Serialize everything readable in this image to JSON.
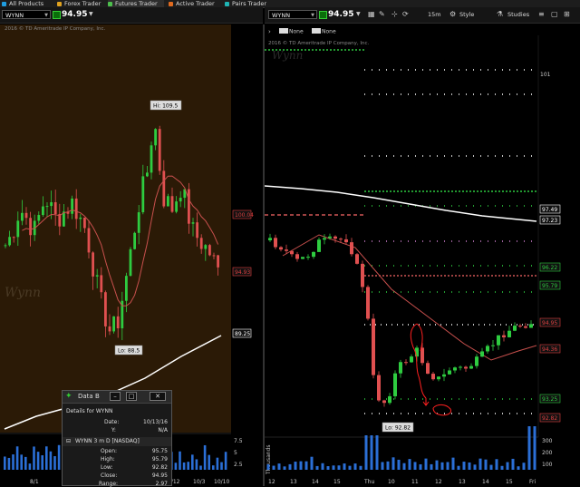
{
  "topbar": {
    "items": [
      {
        "label": "All Products",
        "color": "#1f9de0"
      },
      {
        "label": "Forex Trader",
        "color": "#e0a21f"
      },
      {
        "label": "Futures Trader",
        "color": "#4cbf4c"
      },
      {
        "label": "Active Trader",
        "color": "#e06a1f"
      },
      {
        "label": "Pairs Trader",
        "color": "#1fb5b5"
      }
    ]
  },
  "left_chart": {
    "symbol": "WYNN",
    "price": "94.95",
    "watermark": "2016 © TD Ameritrade IP Company, Inc.",
    "signature": "Wynn",
    "hi_label": "Hi: 109.5",
    "lo_label": "Lo: 88.5",
    "price_badges": [
      {
        "text": "100.04",
        "color": "#e04040",
        "y": 100.04
      },
      {
        "text": "94.93",
        "color": "#e04040",
        "y": 94.93
      },
      {
        "text": "89.25",
        "color": "#ffffff",
        "y": 89.25
      }
    ],
    "x_ticks": [
      "8/1",
      "9/12",
      "10/3",
      "10/10"
    ],
    "volume_ticks": [
      "7.5",
      "5",
      "2.5"
    ]
  },
  "right_chart": {
    "symbol": "WYNN",
    "price": "94.95",
    "interval": "15m",
    "style_label": "Style",
    "studies_label": "Studies",
    "pos_label": "None",
    "ord_label": "None",
    "watermark": "2016 © TD Ameritrade IP Company, Inc.",
    "signature": "Wynn",
    "lo_label": "Lo: 92.82",
    "price_badges": [
      {
        "text": "97.49",
        "color": "#ffffff",
        "y": 97.49
      },
      {
        "text": "97.23",
        "color": "#ffffff",
        "y": 97.23
      },
      {
        "text": "96.22",
        "color": "#2ecc40",
        "y": 96.22
      },
      {
        "text": "95.79",
        "color": "#2ecc40",
        "y": 95.79
      },
      {
        "text": "94.95",
        "color": "#e04040",
        "y": 94.95
      },
      {
        "text": "94.36",
        "color": "#e04040",
        "y": 94.36
      },
      {
        "text": "93.25",
        "color": "#2ecc40",
        "y": 93.25
      },
      {
        "text": "92.82",
        "color": "#e04040",
        "y": 92.82
      }
    ],
    "price_ticks": [
      "101"
    ],
    "x_ticks": [
      "12",
      "13",
      "14",
      "15",
      "Thu",
      "10",
      "11",
      "12",
      "13",
      "14",
      "15",
      "Fri"
    ],
    "volume_ticks": [
      "300",
      "200",
      "100"
    ],
    "volume_axis_label": "Thousands"
  },
  "data_box": {
    "title": "Data B",
    "subtitle": "Details for WYNN",
    "rows_top": [
      {
        "label": "Date:",
        "value": "10/13/16"
      },
      {
        "label": "Y:",
        "value": "N/A"
      }
    ],
    "instrument": "WYNN 3 m D [NASDAQ]",
    "rows_bottom": [
      {
        "label": "Open:",
        "value": "95.75"
      },
      {
        "label": "High:",
        "value": "95.79"
      },
      {
        "label": "Low:",
        "value": "92.82"
      },
      {
        "label": "Close:",
        "value": "94.95"
      },
      {
        "label": "Range:",
        "value": "2.97"
      }
    ]
  }
}
